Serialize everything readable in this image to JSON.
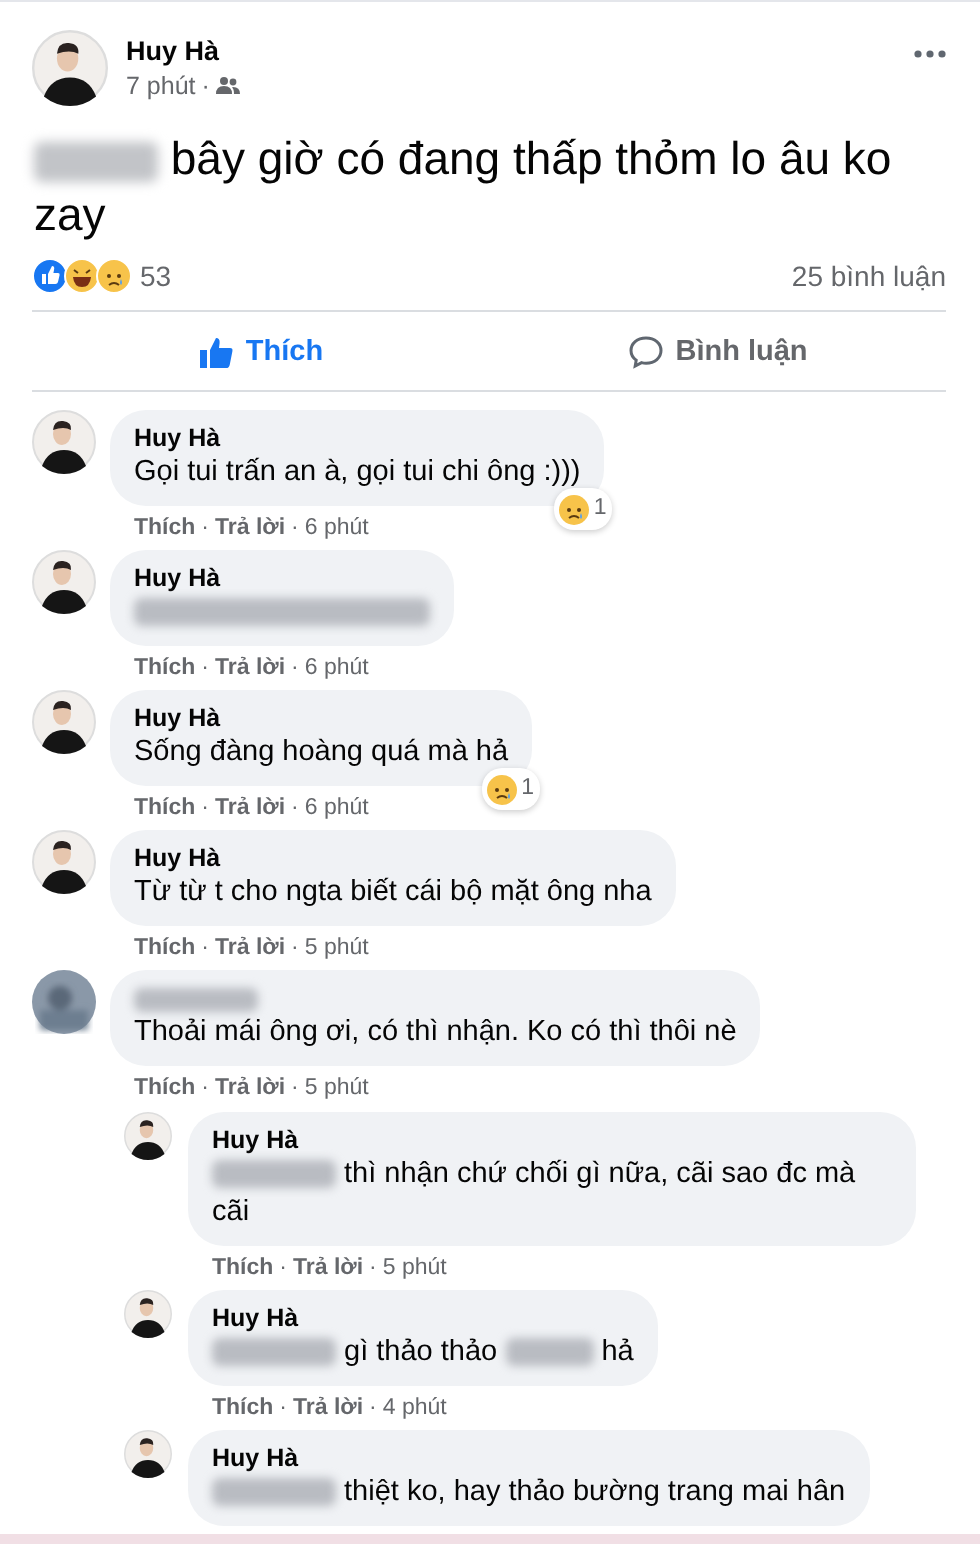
{
  "post": {
    "author": "Huy Hà",
    "time": "7 phút",
    "separator": "·",
    "text": [
      {
        "kind": "blurmedium"
      },
      {
        "kind": "text",
        "text": "bây giờ có đang thấp thỏm lo âu ko zay"
      }
    ],
    "reaction_count": "53",
    "comment_count": "25 bình luận"
  },
  "actions": [
    {
      "kind": "like",
      "label": "Thích",
      "selected": true
    },
    {
      "kind": "comment",
      "label": "Bình luận",
      "selected": false
    }
  ],
  "comments": [
    {
      "avatar": {
        "kind": "person"
      },
      "author": {
        "kind": "text",
        "text": "Huy Hà"
      },
      "segments": [
        {
          "kind": "text",
          "text": "Gọi tui trấn an à, gọi tui chi ông :)))"
        }
      ],
      "meta": {
        "like": "Thích",
        "reply": "Trả lời",
        "time": "6 phút",
        "separator": "·"
      },
      "reaction": {
        "count": "1"
      }
    },
    {
      "avatar": {
        "kind": "person"
      },
      "author": {
        "kind": "text",
        "text": "Huy Hà"
      },
      "segments": [
        {
          "kind": "blurxlong"
        }
      ],
      "meta": {
        "like": "Thích",
        "reply": "Trả lời",
        "time": "6 phút",
        "separator": "·"
      }
    },
    {
      "avatar": {
        "kind": "person"
      },
      "author": {
        "kind": "text",
        "text": "Huy Hà"
      },
      "segments": [
        {
          "kind": "text",
          "text": "Sống đàng hoàng quá mà hả"
        }
      ],
      "meta": {
        "like": "Thích",
        "reply": "Trả lời",
        "time": "6 phút",
        "separator": "·"
      },
      "reaction": {
        "count": "1"
      }
    },
    {
      "avatar": {
        "kind": "person"
      },
      "author": {
        "kind": "text",
        "text": "Huy Hà"
      },
      "segments": [
        {
          "kind": "text",
          "text": "Từ từ t cho ngta biết cái bộ mặt ông nha"
        }
      ],
      "meta": {
        "like": "Thích",
        "reply": "Trả lời",
        "time": "5 phút",
        "separator": "·"
      }
    },
    {
      "avatar": {
        "kind": "blurred"
      },
      "author": {
        "kind": "blurmedium"
      },
      "segments": [
        {
          "kind": "text",
          "text": "Thoải mái ông ơi, có thì nhận. Ko có thì thôi nè"
        }
      ],
      "meta": {
        "like": "Thích",
        "reply": "Trả lời",
        "time": "5 phút",
        "separator": "·"
      },
      "children": [
        {
          "avatar": {
            "kind": "person"
          },
          "author": {
            "kind": "text",
            "text": "Huy Hà"
          },
          "segments": [
            {
              "kind": "blurmedium"
            },
            {
              "kind": "text",
              "text": "thì nhận chứ chối gì nữa, cãi sao đc mà cãi"
            }
          ],
          "meta": {
            "like": "Thích",
            "reply": "Trả lời",
            "time": "5 phút",
            "separator": "·"
          }
        },
        {
          "avatar": {
            "kind": "person"
          },
          "author": {
            "kind": "text",
            "text": "Huy Hà"
          },
          "segments": [
            {
              "kind": "blurmedium"
            },
            {
              "kind": "text",
              "text": "gì thảo thảo"
            },
            {
              "kind": "blurshort"
            },
            {
              "kind": "text",
              "text": "hả"
            }
          ],
          "meta": {
            "like": "Thích",
            "reply": "Trả lời",
            "time": "4 phút",
            "separator": "·"
          }
        },
        {
          "avatar": {
            "kind": "person"
          },
          "author": {
            "kind": "text",
            "text": "Huy Hà"
          },
          "segments": [
            {
              "kind": "blurmedium"
            },
            {
              "kind": "text",
              "text": "thiệt ko, hay thảo bường trang mai hân"
            }
          ]
        }
      ]
    }
  ]
}
